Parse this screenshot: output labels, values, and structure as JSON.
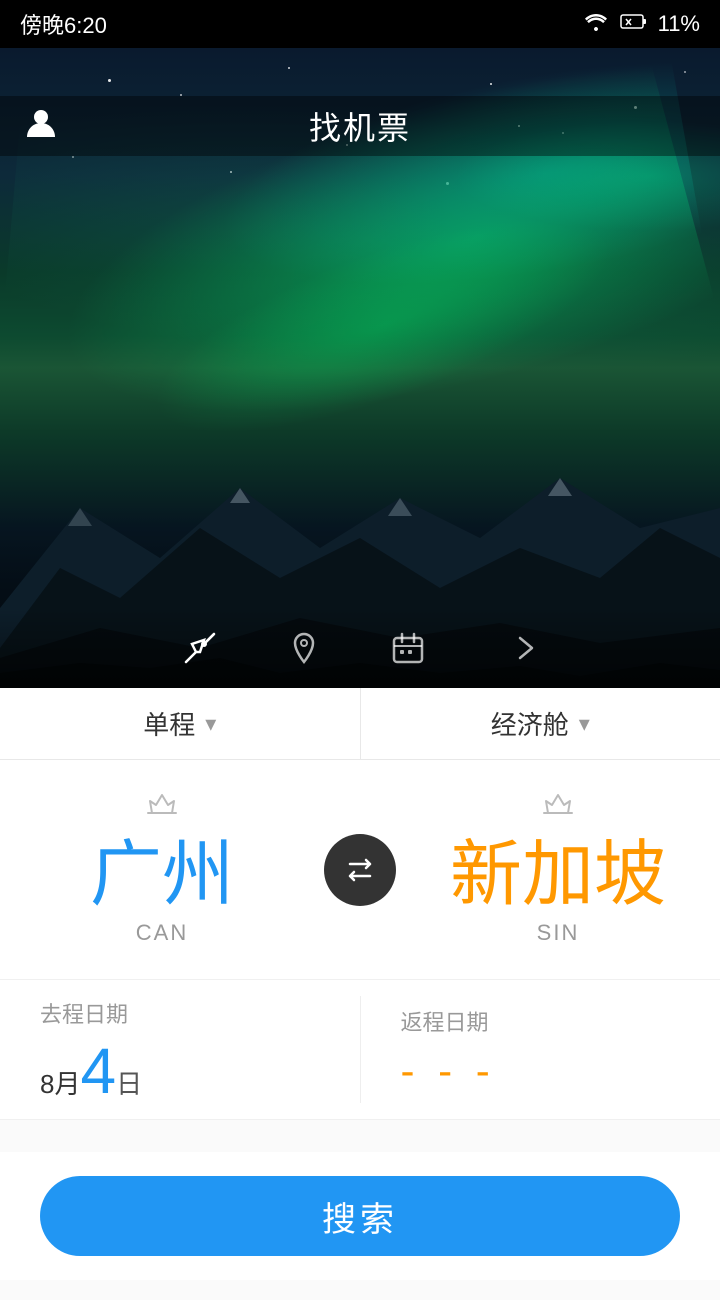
{
  "statusBar": {
    "time": "傍晚6:20",
    "battery": "11%"
  },
  "header": {
    "title": "找机票",
    "profileIcon": "👤"
  },
  "iconBar": {
    "flightIcon": "✈",
    "pinIcon": "📍",
    "calendarIcon": "📅",
    "arrowIcon": "❯"
  },
  "dropdowns": {
    "tripType": "单程",
    "cabinClass": "经济舱"
  },
  "route": {
    "origin": {
      "city": "广州",
      "code": "CAN"
    },
    "dest": {
      "city": "新加坡",
      "code": "SIN"
    },
    "swapIcon": "⇄"
  },
  "dates": {
    "departLabel": "去程日期",
    "returnLabel": "返程日期",
    "departMonth": "8月",
    "departDay": "4",
    "departDaySuffix": "日",
    "returnPlaceholder": "- - -"
  },
  "searchBtn": "搜索"
}
